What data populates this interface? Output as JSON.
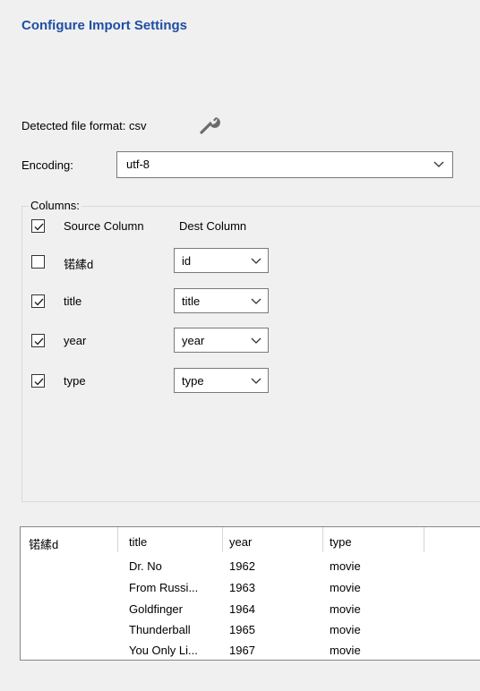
{
  "dialog": {
    "title": "Configure Import Settings"
  },
  "format": {
    "label": "Detected file format: csv",
    "icon": "wrench-icon"
  },
  "encoding": {
    "label": "Encoding:",
    "value": "utf-8"
  },
  "columns": {
    "legend": "Columns:",
    "header_source": "Source Column",
    "header_dest": "Dest Column",
    "header_checked": true,
    "rows": [
      {
        "source": "锘縤d",
        "dest": "id",
        "checked": false
      },
      {
        "source": "title",
        "dest": "title",
        "checked": true
      },
      {
        "source": "year",
        "dest": "year",
        "checked": true
      },
      {
        "source": "type",
        "dest": "type",
        "checked": true
      }
    ]
  },
  "preview": {
    "headers": [
      "锘縤d",
      "title",
      "year",
      "type"
    ],
    "rows": [
      [
        "",
        "Dr. No",
        "1962",
        "movie"
      ],
      [
        "",
        "From Russi...",
        "1963",
        "movie"
      ],
      [
        "",
        "Goldfinger",
        "1964",
        "movie"
      ],
      [
        "",
        "Thunderball",
        "1965",
        "movie"
      ],
      [
        "",
        "You Only Li...",
        "1967",
        "movie"
      ]
    ]
  },
  "colors": {
    "title": "#1f4ea3",
    "window_bg": "#f0f0f0"
  }
}
